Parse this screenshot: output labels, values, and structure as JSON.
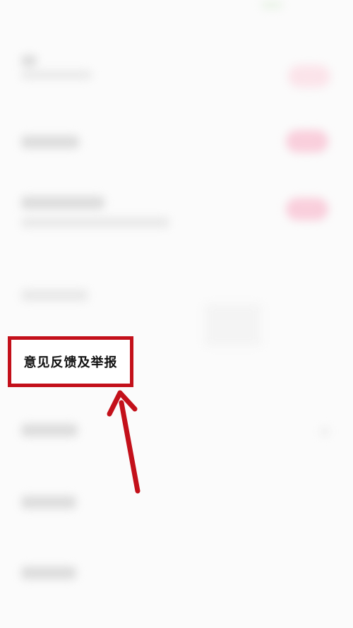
{
  "highlight": {
    "label": "意见反馈及举报",
    "border_color": "#c3101a"
  },
  "annotation": {
    "arrow_color": "#c3101a",
    "arrow_target": "highlight-box"
  },
  "background_icons": [
    "toggle-icon",
    "toggle-icon",
    "toggle-icon",
    "chevron-right-icon"
  ]
}
